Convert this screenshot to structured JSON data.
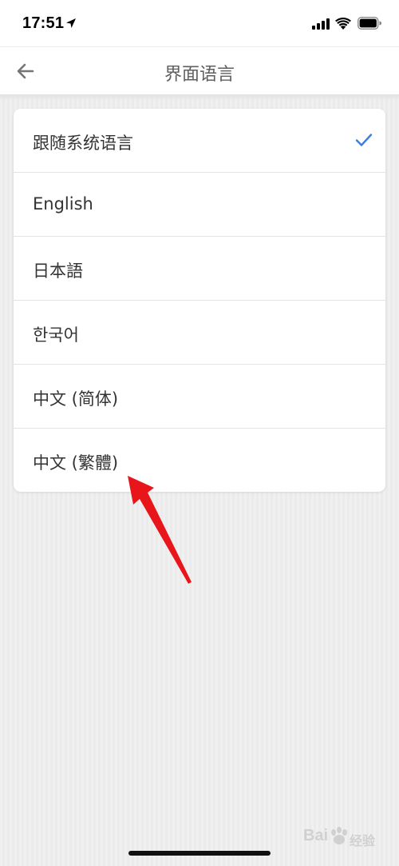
{
  "status_bar": {
    "time": "17:51"
  },
  "header": {
    "title": "界面语言",
    "back_icon": "back-arrow-icon"
  },
  "languages": [
    {
      "label": "跟随系统语言",
      "selected": true
    },
    {
      "label": "English",
      "selected": false
    },
    {
      "label": "日本語",
      "selected": false
    },
    {
      "label": "한국어",
      "selected": false
    },
    {
      "label": "中文 (简体)",
      "selected": false
    },
    {
      "label": "中文 (繁體)",
      "selected": false
    }
  ],
  "watermark": {
    "left_text": "Bai",
    "right_text": "经验"
  },
  "colors": {
    "accent": "#3d7de0",
    "annotation": "#e8151b"
  }
}
